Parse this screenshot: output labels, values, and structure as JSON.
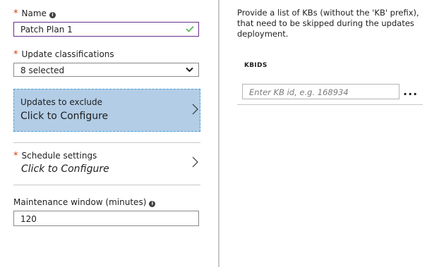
{
  "left": {
    "name": {
      "label": "Name",
      "value": "Patch Plan 1",
      "required_mark": "*"
    },
    "update_classifications": {
      "label": "Update classifications",
      "value": "8 selected",
      "required_mark": "*"
    },
    "updates_to_exclude": {
      "title": "Updates to exclude",
      "action": "Click to Configure"
    },
    "schedule_settings": {
      "title": "Schedule settings",
      "action": "Click to Configure",
      "required_mark": "*"
    },
    "maintenance_window": {
      "label": "Maintenance window (minutes)",
      "value": "120"
    }
  },
  "right": {
    "description": "Provide a list of KBs (without the 'KB' prefix), that need to be skipped during the updates deployment.",
    "column_header": "KBIDS",
    "kb_input_placeholder": "Enter KB id, e.g. 168934",
    "more_label": "..."
  },
  "colors": {
    "selected_panel": "#b3cde6",
    "required": "#d83b01",
    "valid_check": "#5cb85c",
    "name_border": "#6b2d8c"
  },
  "icons": [
    "info-icon",
    "checkmark-icon",
    "chevron-down-icon",
    "chevron-right-icon",
    "more-icon"
  ]
}
